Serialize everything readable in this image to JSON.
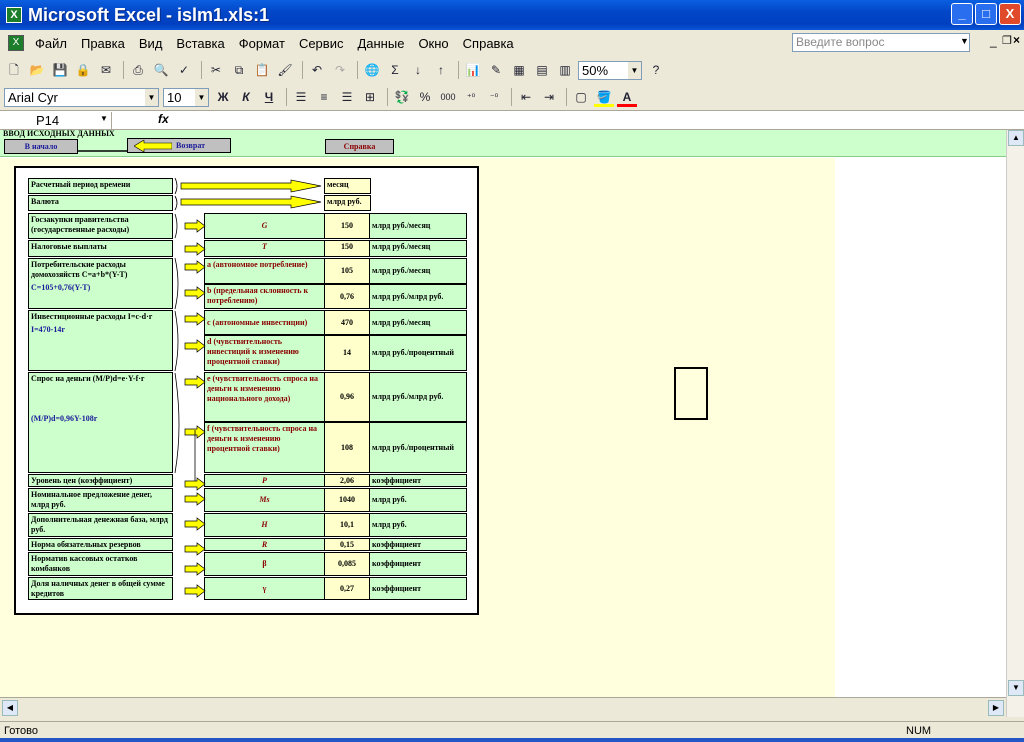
{
  "window": {
    "title": "Microsoft Excel - islm1.xls:1",
    "minimize": "_",
    "maximize": "□",
    "close": "X"
  },
  "menu": [
    "Файл",
    "Правка",
    "Вид",
    "Вставка",
    "Формат",
    "Сервис",
    "Данные",
    "Окно",
    "Справка"
  ],
  "ask_placeholder": "Введите вопрос",
  "toolbar": {
    "zoom": "50%",
    "font": "Arial Cyr",
    "size": "10",
    "bold": "Ж",
    "italic": "К",
    "underline": "Ч",
    "percent": "%",
    "thousands": "000"
  },
  "formula": {
    "cell_ref": "P14",
    "fx": "fx"
  },
  "sheet": {
    "header": "ВВОД ИСХОДНЫХ ДАННЫХ",
    "btn_start": "В начало",
    "btn_back": "Возврат",
    "btn_help": "Справка",
    "rows": [
      {
        "label": "Расчетный период времени",
        "sym": "",
        "val": "",
        "unit": "месяц"
      },
      {
        "label": "Валюта",
        "sym": "",
        "val": "",
        "unit": "млрд руб."
      },
      {
        "label": "Госзакупки правительства (государственные расходы)",
        "sym": "G",
        "val": "150",
        "unit": "млрд руб./месяц"
      },
      {
        "label": "Налоговые выплаты",
        "sym": "T",
        "val": "150",
        "unit": "млрд руб./месяц"
      },
      {
        "label": "Потребительские расходы домохозяйств C=a+b*(Y-T)",
        "formula": "C=105+0,76(Y-T)",
        "sym": "a (автономное потребление)",
        "val": "105",
        "unit": "млрд руб./месяц"
      },
      {
        "sym": "b (предельная склонность к потреблению)",
        "val": "0,76",
        "unit": "млрд руб./млрд руб."
      },
      {
        "label": "Инвестиционные расходы I=c-d·r",
        "formula": "I=470-14r",
        "sym": "c (автономные инвестиции)",
        "val": "470",
        "unit": "млрд руб./месяц"
      },
      {
        "sym": "d (чувствительность инвестиций к изменению процентной ставки)",
        "val": "14",
        "unit": "млрд руб./процентный"
      },
      {
        "label": "Спрос на деньги (M/P)d=e·Y-f·r",
        "formula": "(M/P)d=0,96Y-108r",
        "sym": "e (чувствительность спроса на деньги к изменению национального дохода)",
        "val": "0,96",
        "unit": "млрд руб./млрд руб."
      },
      {
        "sym": "f (чувствительность спроса на деньги к изменению процентной ставки)",
        "val": "108",
        "unit": "млрд руб./процентный"
      },
      {
        "label": "Уровень цен (коэффициент)",
        "sym": "P",
        "val": "2,06",
        "unit": "коэффициент"
      },
      {
        "label": "Номинальное предложение денег, млрд руб.",
        "sym": "Ms",
        "val": "1040",
        "unit": "млрд руб."
      },
      {
        "label": "Дополнительная денежная база, млрд руб.",
        "sym": "H",
        "val": "10,1",
        "unit": "млрд руб."
      },
      {
        "label": "Норма обязательных резервов",
        "sym": "R",
        "val": "0,15",
        "unit": "коэффициент"
      },
      {
        "label": "Норматив кассовых остатков комбанков",
        "sym": "β",
        "val": "0,085",
        "unit": "коэффициент"
      },
      {
        "label": "Доля наличных денег в общей сумме кредитов",
        "sym": "γ",
        "val": "0,27",
        "unit": "коэффициент"
      }
    ]
  },
  "status": {
    "left": "Готово",
    "num": "NUM"
  }
}
